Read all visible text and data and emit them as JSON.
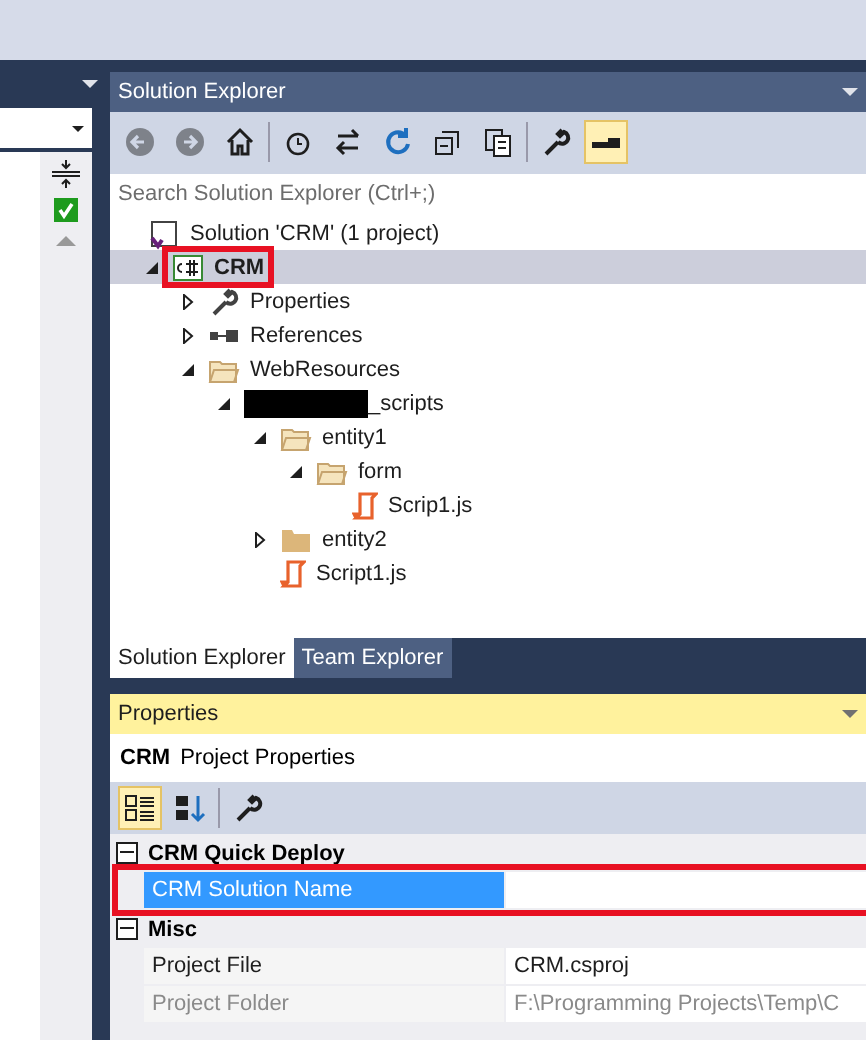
{
  "solution_explorer": {
    "title": "Solution Explorer",
    "toolbar": [
      [
        {
          "kind": "back",
          "disabled": true,
          "selected": false
        },
        {
          "kind": "forward",
          "disabled": true,
          "selected": false
        },
        {
          "kind": "home",
          "disabled": false,
          "selected": false
        }
      ],
      [
        {
          "kind": "history",
          "disabled": false,
          "selected": false
        },
        {
          "kind": "sync",
          "disabled": false,
          "selected": false
        },
        {
          "kind": "refresh",
          "disabled": false,
          "selected": false
        },
        {
          "kind": "collapse",
          "disabled": false,
          "selected": false
        },
        {
          "kind": "copy",
          "disabled": false,
          "selected": false
        }
      ],
      [
        {
          "kind": "properties",
          "disabled": false,
          "selected": false
        },
        {
          "kind": "preview",
          "disabled": false,
          "selected": true
        }
      ]
    ],
    "search": {
      "placeholder": "Search Solution Explorer (Ctrl+;)"
    },
    "tree": [
      {
        "label": "Solution 'CRM' (1 project)",
        "kind": "solution",
        "selected": false,
        "highlighted": false,
        "children": [
          {
            "label": "CRM",
            "kind": "csharp-project",
            "bold": true,
            "expanded": true,
            "selected": true,
            "highlighted": true,
            "children": [
              {
                "label": "Properties",
                "kind": "wrench",
                "expanded": false,
                "selected": false,
                "highlighted": false
              },
              {
                "label": "References",
                "kind": "references",
                "expanded": false,
                "selected": false,
                "highlighted": false
              },
              {
                "label": "WebResources",
                "kind": "folder-open",
                "expanded": true,
                "selected": false,
                "highlighted": false,
                "children": [
                  {
                    "label": "_scripts",
                    "kind": "redacted",
                    "expanded": true,
                    "selected": false,
                    "highlighted": false,
                    "children": [
                      {
                        "label": "entity1",
                        "kind": "folder-open",
                        "expanded": true,
                        "selected": false,
                        "highlighted": false,
                        "children": [
                          {
                            "label": "form",
                            "kind": "folder-open",
                            "expanded": true,
                            "selected": false,
                            "highlighted": false,
                            "children": [
                              {
                                "label": "Scrip1.js",
                                "kind": "js-file",
                                "selected": false,
                                "highlighted": false
                              }
                            ]
                          }
                        ]
                      },
                      {
                        "label": "entity2",
                        "kind": "folder",
                        "expanded": false,
                        "selected": false,
                        "highlighted": false
                      },
                      {
                        "label": "Script1.js",
                        "kind": "js-file",
                        "selected": false,
                        "highlighted": false
                      }
                    ]
                  }
                ]
              }
            ]
          }
        ]
      }
    ],
    "tabs": [
      {
        "label": "Solution Explorer",
        "selected": true
      },
      {
        "label": "Team Explorer",
        "selected": false
      }
    ]
  },
  "properties": {
    "title": "Properties",
    "object_name": "CRM",
    "object_type": "Project Properties",
    "toolbar": [
      [
        {
          "kind": "categorized",
          "selected": true
        },
        {
          "kind": "alphabetical",
          "selected": false
        }
      ],
      [
        {
          "kind": "property-pages",
          "selected": false
        }
      ]
    ],
    "categories": [
      {
        "name": "CRM Quick Deploy",
        "expanded": true,
        "rows": [
          {
            "name": "CRM Solution Name",
            "selected": true,
            "disabled": false,
            "highlighted": true
          }
        ]
      },
      {
        "name": "Misc",
        "expanded": true,
        "rows": [
          {
            "name": "Project File",
            "value": "CRM.csproj",
            "selected": false,
            "disabled": false,
            "highlighted": false
          },
          {
            "name": "Project Folder",
            "value": "F:\\Programming Projects\\Temp\\C",
            "selected": false,
            "disabled": true,
            "highlighted": false
          }
        ]
      }
    ]
  }
}
